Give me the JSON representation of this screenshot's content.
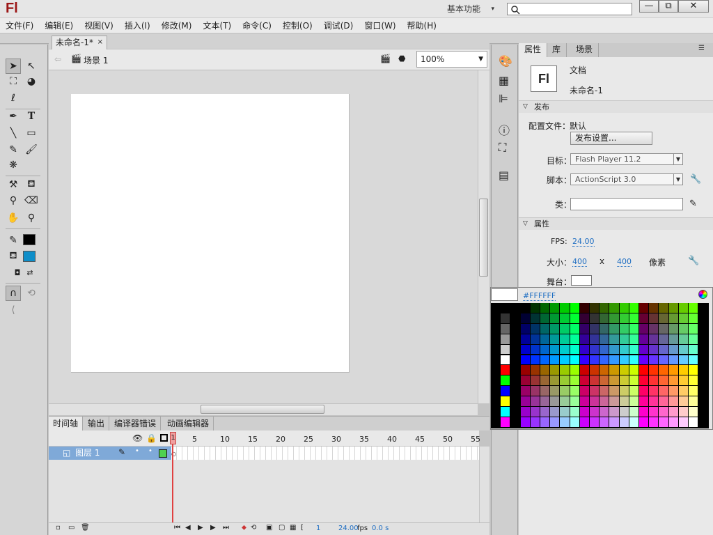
{
  "app": {
    "logo": "Fl",
    "workspace": "基本功能"
  },
  "window_buttons": {
    "minimize": "—",
    "restore": "⧉",
    "close": "✕"
  },
  "menu": [
    "文件(F)",
    "编辑(E)",
    "视图(V)",
    "插入(I)",
    "修改(M)",
    "文本(T)",
    "命令(C)",
    "控制(O)",
    "调试(D)",
    "窗口(W)",
    "帮助(H)"
  ],
  "document": {
    "tab_title": "未命名-1*",
    "close": "×",
    "scene": "场景 1",
    "zoom": "100%"
  },
  "timeline": {
    "tabs": [
      "时间轴",
      "输出",
      "编译器错误",
      "动画编辑器"
    ],
    "frame_numbers": [
      "1",
      "5",
      "10",
      "15",
      "20",
      "25",
      "30",
      "35",
      "40",
      "45",
      "50",
      "55"
    ],
    "layer_name": "图层 1",
    "footer": {
      "current_frame": "1",
      "fps": "24.00",
      "fps_unit": "fps",
      "time": "0.0 s"
    }
  },
  "properties": {
    "tabs": [
      "属性",
      "库",
      "场景"
    ],
    "doc_icon": "Fl",
    "doc_type": "文档",
    "doc_name": "未命名-1",
    "publish": {
      "section": "发布",
      "profile_label": "配置文件：",
      "profile_value": "默认",
      "settings_button": "发布设置...",
      "target_label": "目标：",
      "target_value": "Flash Player 11.2",
      "script_label": "脚本：",
      "script_value": "ActionScript 3.0",
      "class_label": "类："
    },
    "props": {
      "section": "属性",
      "fps_label": "FPS:",
      "fps_value": "24.00",
      "size_label": "大小：",
      "width": "400",
      "x": "x",
      "height": "400",
      "unit": "像素",
      "stage_label": "舞台："
    }
  },
  "swatches": {
    "hex": "#FFFFFF"
  }
}
